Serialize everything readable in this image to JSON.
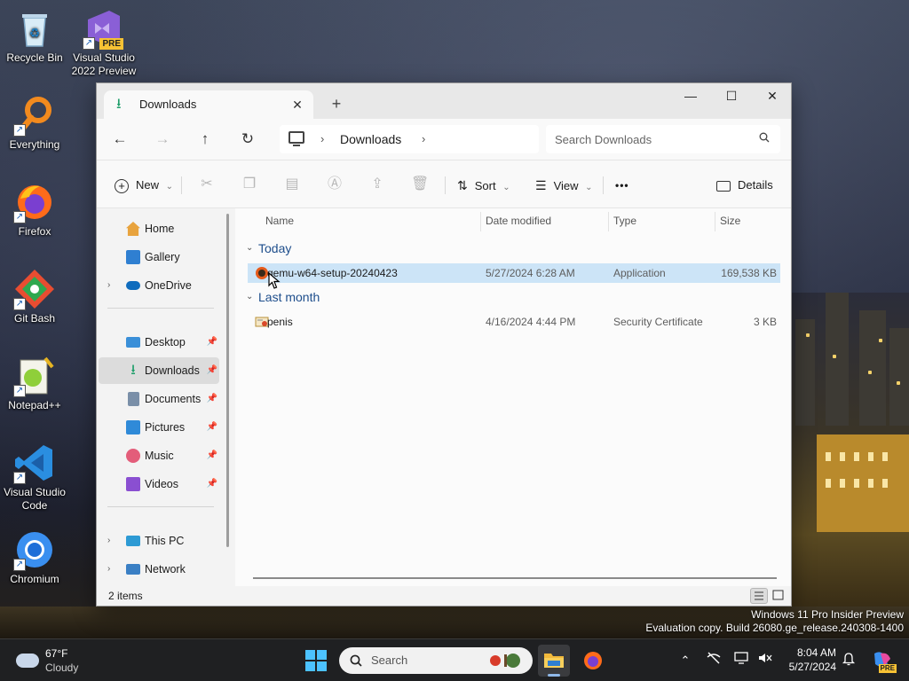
{
  "desktop": {
    "icons": [
      {
        "label": "Recycle Bin"
      },
      {
        "label": "Visual Studio 2022 Preview",
        "badge": "PRE"
      },
      {
        "label": "Everything"
      },
      {
        "label": "Firefox"
      },
      {
        "label": "Git Bash"
      },
      {
        "label": "Notepad++"
      },
      {
        "label": "Visual Studio Code"
      },
      {
        "label": "Chromium"
      }
    ],
    "watermark": {
      "line1": "Windows 11 Pro Insider Preview",
      "line2": "Evaluation copy. Build 26080.ge_release.240308-1400"
    }
  },
  "explorer": {
    "tab_title": "Downloads",
    "tab_close": "✕",
    "new_tab": "+",
    "window_controls": {
      "minimize": "—",
      "maximize": "☐",
      "close": "✕"
    },
    "nav": {
      "back": "←",
      "forward": "→",
      "up": "↑",
      "refresh": "↻"
    },
    "breadcrumb": {
      "sep": "›",
      "location": "Downloads"
    },
    "search": {
      "placeholder": "Search Downloads"
    },
    "toolbar": {
      "new_label": "New",
      "sort_label": "Sort",
      "view_label": "View",
      "more_label": "•••",
      "details_label": "Details",
      "dropdown": "⌄"
    },
    "sidebar": {
      "items": [
        {
          "label": "Home",
          "icon": "home-icon",
          "color": "#e8a33d"
        },
        {
          "label": "Gallery",
          "icon": "gallery-icon",
          "color": "#2f7fd1"
        },
        {
          "label": "OneDrive",
          "icon": "onedrive-icon",
          "color": "#0f6cbd"
        },
        {
          "label": "Desktop",
          "icon": "desktop-icon",
          "color": "#3a8fd8"
        },
        {
          "label": "Downloads",
          "icon": "downloads-icon",
          "color": "#1e9e6a"
        },
        {
          "label": "Documents",
          "icon": "documents-icon",
          "color": "#7a8fa8"
        },
        {
          "label": "Pictures",
          "icon": "pictures-icon",
          "color": "#2f8ad8"
        },
        {
          "label": "Music",
          "icon": "music-icon",
          "color": "#e35d7a"
        },
        {
          "label": "Videos",
          "icon": "videos-icon",
          "color": "#8a4fd1"
        },
        {
          "label": "This PC",
          "icon": "this-pc-icon",
          "color": "#2d9ad4"
        },
        {
          "label": "Network",
          "icon": "network-icon",
          "color": "#3a7fc4"
        }
      ],
      "chevron": "›",
      "pin": "📌"
    },
    "columns": {
      "name": "Name",
      "date": "Date modified",
      "type": "Type",
      "size": "Size"
    },
    "groups": [
      {
        "label": "Today",
        "files": [
          {
            "name": "qemu-w64-setup-20240423",
            "date": "5/27/2024 6:28 AM",
            "type": "Application",
            "size": "169,538 KB"
          }
        ]
      },
      {
        "label": "Last month",
        "files": [
          {
            "name": "penis",
            "date": "4/16/2024 4:44 PM",
            "type": "Security Certificate",
            "size": "3 KB"
          }
        ]
      }
    ],
    "group_chevron": "⌄",
    "status": "2 items"
  },
  "taskbar": {
    "weather": {
      "temp": "67°F",
      "condition": "Cloudy"
    },
    "search_label": "Search",
    "clock": {
      "time": "8:04 AM",
      "date": "5/27/2024"
    },
    "tray": {
      "chevron": "⌃",
      "badge": "PRE"
    }
  }
}
